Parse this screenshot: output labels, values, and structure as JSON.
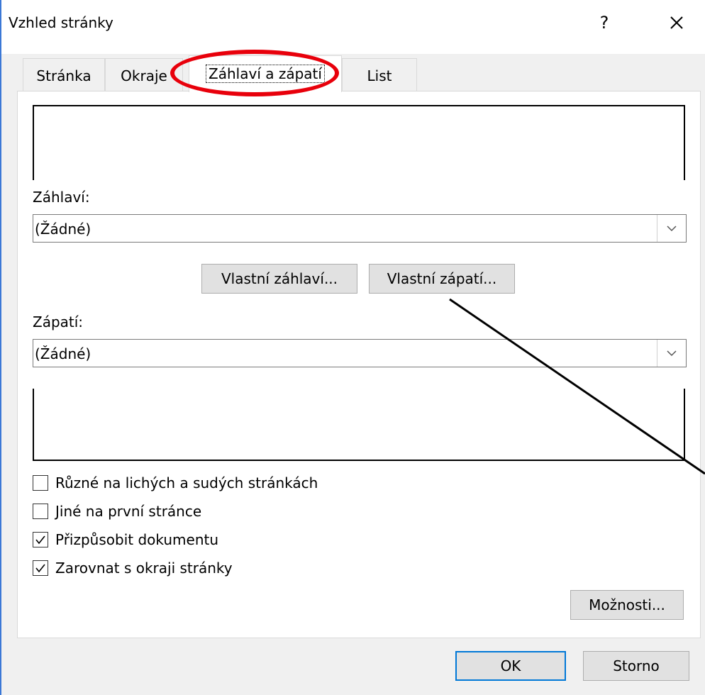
{
  "dialog": {
    "title": "Vzhled stránky",
    "help": "?"
  },
  "tabs": [
    {
      "label": "Stránka",
      "active": false
    },
    {
      "label": "Okraje",
      "active": false
    },
    {
      "label": "Záhlaví a zápatí",
      "active": true
    },
    {
      "label": "List",
      "active": false
    }
  ],
  "header": {
    "label": "Záhlaví:",
    "value": "(Žádné)"
  },
  "buttons": {
    "custom_header": "Vlastní záhlaví...",
    "custom_footer": "Vlastní zápatí...",
    "options": "Možnosti...",
    "ok": "OK",
    "cancel": "Storno"
  },
  "footer": {
    "label": "Zápatí:",
    "value": "(Žádné)"
  },
  "checkboxes": [
    {
      "label": "Různé na lichých a sudých stránkách",
      "checked": false
    },
    {
      "label": "Jiné na první stránce",
      "checked": false
    },
    {
      "label": "Přizpůsobit dokumentu",
      "checked": true
    },
    {
      "label": "Zarovnat s okraji stránky",
      "checked": true
    }
  ],
  "colors": {
    "annotation": "#e8000b",
    "accent": "#0078d7",
    "window_border": "#3b78d6"
  }
}
